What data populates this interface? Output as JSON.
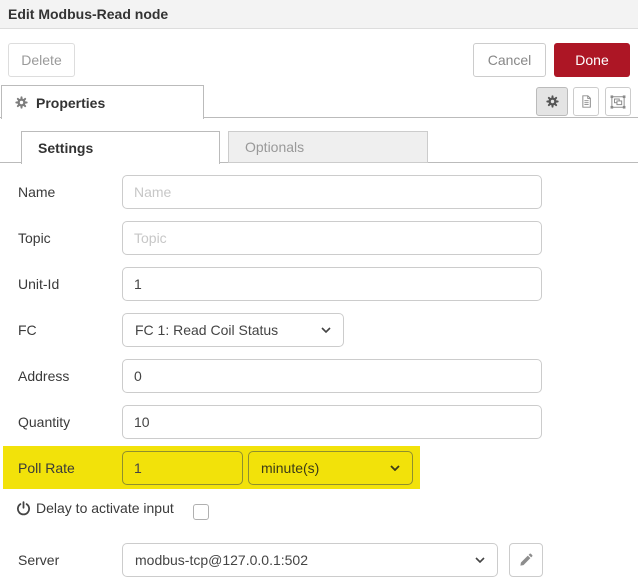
{
  "window": {
    "title": "Edit Modbus-Read node"
  },
  "toolbar": {
    "delete": "Delete",
    "cancel": "Cancel",
    "done": "Done"
  },
  "properties_tab": {
    "label": "Properties"
  },
  "subtabs": {
    "settings": "Settings",
    "optionals": "Optionals"
  },
  "form": {
    "name": {
      "label": "Name",
      "placeholder": "Name",
      "value": ""
    },
    "topic": {
      "label": "Topic",
      "placeholder": "Topic",
      "value": ""
    },
    "unit_id": {
      "label": "Unit-Id",
      "value": "1"
    },
    "fc": {
      "label": "FC",
      "value": "FC 1: Read Coil Status"
    },
    "address": {
      "label": "Address",
      "value": "0"
    },
    "quantity": {
      "label": "Quantity",
      "value": "10"
    },
    "poll_rate": {
      "label": "Poll Rate",
      "value": "1",
      "unit": "minute(s)"
    },
    "delay": {
      "label": "Delay to activate input",
      "checked": false
    },
    "server": {
      "label": "Server",
      "value": "modbus-tcp@127.0.0.1:502"
    }
  },
  "colors": {
    "done_red": "#AD1625",
    "highlight_yellow": "#F2E20A",
    "header_bg": "#F3F3F3"
  }
}
